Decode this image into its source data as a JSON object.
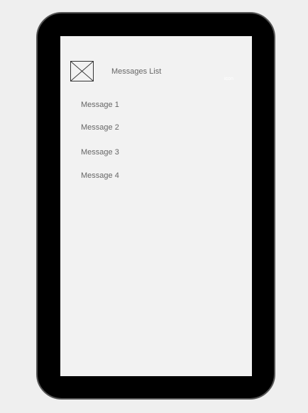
{
  "header": {
    "image_icon": "image-placeholder-icon",
    "title": "Messages List",
    "corner_label": "icon"
  },
  "messages": [
    {
      "label": "Message 1"
    },
    {
      "label": "Message 2"
    },
    {
      "label": "Message 3"
    },
    {
      "label": "Message 4"
    }
  ],
  "colors": {
    "page_background": "#efefef",
    "device_frame": "#000000",
    "screen_background": "#f2f2f2",
    "text": "#666666"
  }
}
